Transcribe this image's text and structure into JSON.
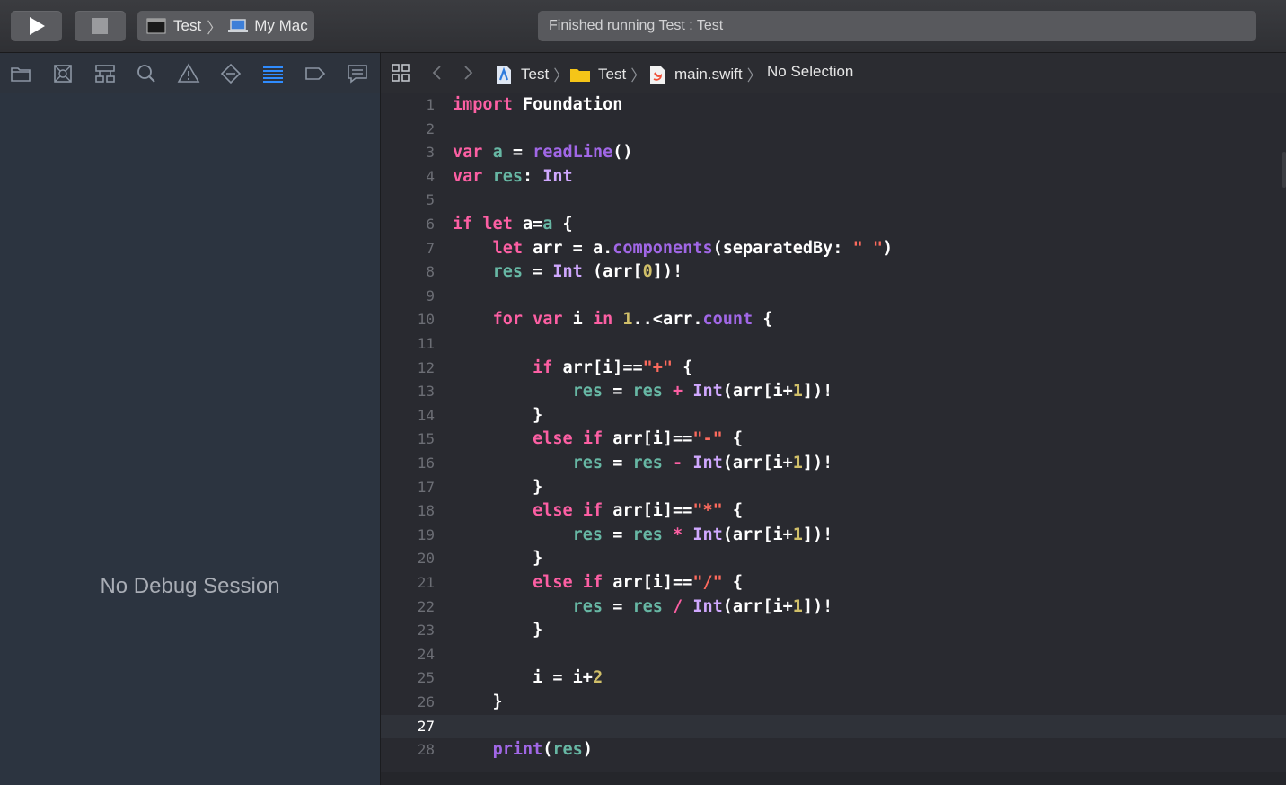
{
  "toolbar": {
    "scheme": {
      "target": "Test",
      "destination": "My Mac"
    },
    "activity_text": "Finished running Test : Test"
  },
  "navigator": {
    "tabs": [
      "project-navigator",
      "source-control",
      "symbol-navigator",
      "find-navigator",
      "issue-navigator",
      "test-navigator",
      "debug-navigator",
      "breakpoint-navigator",
      "report-navigator"
    ],
    "active_tab": "debug-navigator",
    "empty_message": "No Debug Session"
  },
  "jump_bar": {
    "crumbs": [
      "Test",
      "Test",
      "main.swift",
      "No Selection"
    ]
  },
  "editor": {
    "current_line": 27,
    "lines": [
      {
        "n": "1"
      },
      {
        "n": "2"
      },
      {
        "n": "3"
      },
      {
        "n": "4"
      },
      {
        "n": "5"
      },
      {
        "n": "6"
      },
      {
        "n": "7"
      },
      {
        "n": "8"
      },
      {
        "n": "9"
      },
      {
        "n": "10"
      },
      {
        "n": "11"
      },
      {
        "n": "12"
      },
      {
        "n": "13"
      },
      {
        "n": "14"
      },
      {
        "n": "15"
      },
      {
        "n": "16"
      },
      {
        "n": "17"
      },
      {
        "n": "18"
      },
      {
        "n": "19"
      },
      {
        "n": "20"
      },
      {
        "n": "21"
      },
      {
        "n": "22"
      },
      {
        "n": "23"
      },
      {
        "n": "24"
      },
      {
        "n": "25"
      },
      {
        "n": "26"
      },
      {
        "n": "27"
      },
      {
        "n": "28"
      }
    ],
    "tokens": {
      "l1": [
        "import",
        " Foundation"
      ],
      "l3": [
        "var",
        " ",
        "a",
        " = ",
        "readLine",
        "()"
      ],
      "l4": [
        "var",
        " ",
        "res",
        ": ",
        "Int"
      ],
      "l6": [
        "if",
        " ",
        "let",
        " a=",
        "a",
        " {"
      ],
      "l7": [
        "    ",
        "let",
        " arr = a.",
        "components",
        "(separatedBy: ",
        "\" \"",
        ")"
      ],
      "l8": [
        "    ",
        "res",
        " = ",
        "Int",
        " (arr[",
        "0",
        "])!"
      ],
      "l10": [
        "    ",
        "for",
        " ",
        "var",
        " i ",
        "in",
        " ",
        "1",
        "..<arr.",
        "count",
        " {"
      ],
      "l12": [
        "        ",
        "if",
        " arr[i]==",
        "\"+\"",
        " {"
      ],
      "l13": [
        "            ",
        "res",
        " = ",
        "res",
        " + ",
        "Int",
        "(arr[i+",
        "1",
        "])!"
      ],
      "l14": [
        "        }"
      ],
      "l15": [
        "        ",
        "else",
        " ",
        "if",
        " arr[i]==",
        "\"-\"",
        " {"
      ],
      "l16": [
        "            ",
        "res",
        " = ",
        "res",
        " - ",
        "Int",
        "(arr[i+",
        "1",
        "])!"
      ],
      "l17": [
        "        }"
      ],
      "l18": [
        "        ",
        "else",
        " ",
        "if",
        " arr[i]==",
        "\"*\"",
        " {"
      ],
      "l19": [
        "            ",
        "res",
        " = ",
        "res",
        " * ",
        "Int",
        "(arr[i+",
        "1",
        "])!"
      ],
      "l20": [
        "        }"
      ],
      "l21": [
        "        ",
        "else",
        " ",
        "if",
        " arr[i]==",
        "\"/\"",
        " {"
      ],
      "l22": [
        "            ",
        "res",
        " = ",
        "res",
        " / ",
        "Int",
        "(arr[i+",
        "1",
        "])!"
      ],
      "l23": [
        "        }"
      ],
      "l25": [
        "        i = i+",
        "2"
      ],
      "l26": [
        "    }"
      ],
      "l28": [
        "    ",
        "print",
        "(",
        "res",
        ")"
      ]
    }
  },
  "colors": {
    "keyword": "#fc5fa3",
    "function": "#a167e6",
    "variable": "#67b7a4",
    "type": "#d0a8ff",
    "number": "#d0bf69",
    "string": "#fc6a5d",
    "editor_bg": "#292a30",
    "navigator_bg": "#2c3440"
  }
}
